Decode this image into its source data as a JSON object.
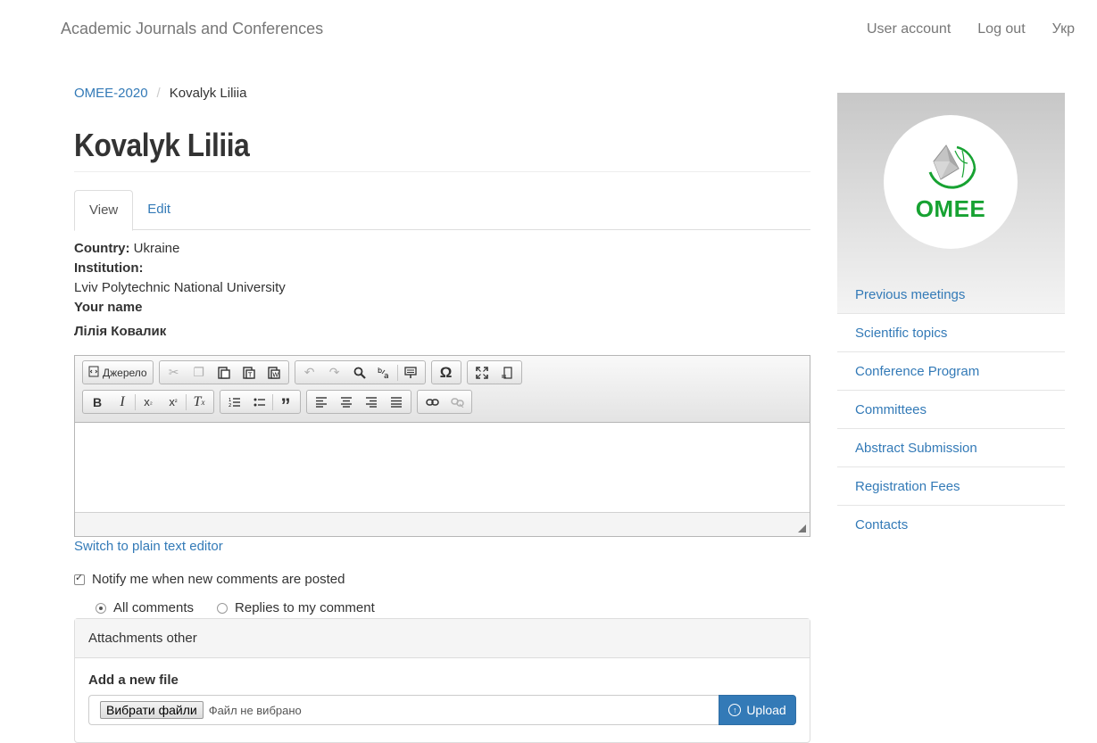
{
  "navbar": {
    "site_name": "Academic Journals and Conferences",
    "links": [
      "User account",
      "Log out",
      "Укр"
    ]
  },
  "breadcrumb": {
    "parent": "OMEE-2020",
    "current": "Kovalyk Liliia"
  },
  "page_title": "Kovalyk Liliia",
  "tabs": [
    {
      "label": "View",
      "active": true
    },
    {
      "label": "Edit",
      "active": false
    }
  ],
  "fields": {
    "country_label": "Country:",
    "country_value": "Ukraine",
    "institution_label": "Institution:",
    "institution_value": "Lviv Polytechnic National University",
    "your_name_label": "Your name",
    "your_name_value": "Лілія Ковалик"
  },
  "editor": {
    "source_label": "Джерело",
    "toolbar_icons": {
      "row1": [
        "source-icon",
        "cut-icon",
        "copy-icon",
        "paste-icon",
        "paste-text-icon",
        "paste-word-icon",
        "undo-icon",
        "redo-icon",
        "find-icon",
        "replace-icon",
        "format-icon",
        "special-char-icon",
        "maximize-icon",
        "show-blocks-icon"
      ],
      "row2": [
        "bold-icon",
        "italic-icon",
        "subscript-icon",
        "superscript-icon",
        "remove-format-icon",
        "numbered-list-icon",
        "bulleted-list-icon",
        "blockquote-icon",
        "align-left-icon",
        "align-center-icon",
        "align-right-icon",
        "justify-icon",
        "link-icon",
        "unlink-icon"
      ]
    },
    "switch_label": "Switch to plain text editor"
  },
  "notify": {
    "label": "Notify me when new comments are posted",
    "checked": true,
    "options": [
      {
        "label": "All comments",
        "selected": true
      },
      {
        "label": "Replies to my comment",
        "selected": false
      }
    ]
  },
  "attachments": {
    "heading": "Attachments other",
    "add_label": "Add a new file",
    "choose_button": "Вибрати файли",
    "no_file_text": "Файл не вибрано",
    "upload_button": "Upload"
  },
  "sidebar": {
    "logo_text": "OMEE",
    "logo_colors": {
      "green": "#17a232",
      "gray": "#9a9a9a"
    },
    "menu": [
      "Previous meetings",
      "Scientific topics",
      "Conference Program",
      "Committees",
      "Abstract Submission",
      "Registration Fees",
      "Contacts"
    ]
  },
  "colors": {
    "link": "#337ab7",
    "primary_button": "#337ab7",
    "text": "#333333"
  }
}
